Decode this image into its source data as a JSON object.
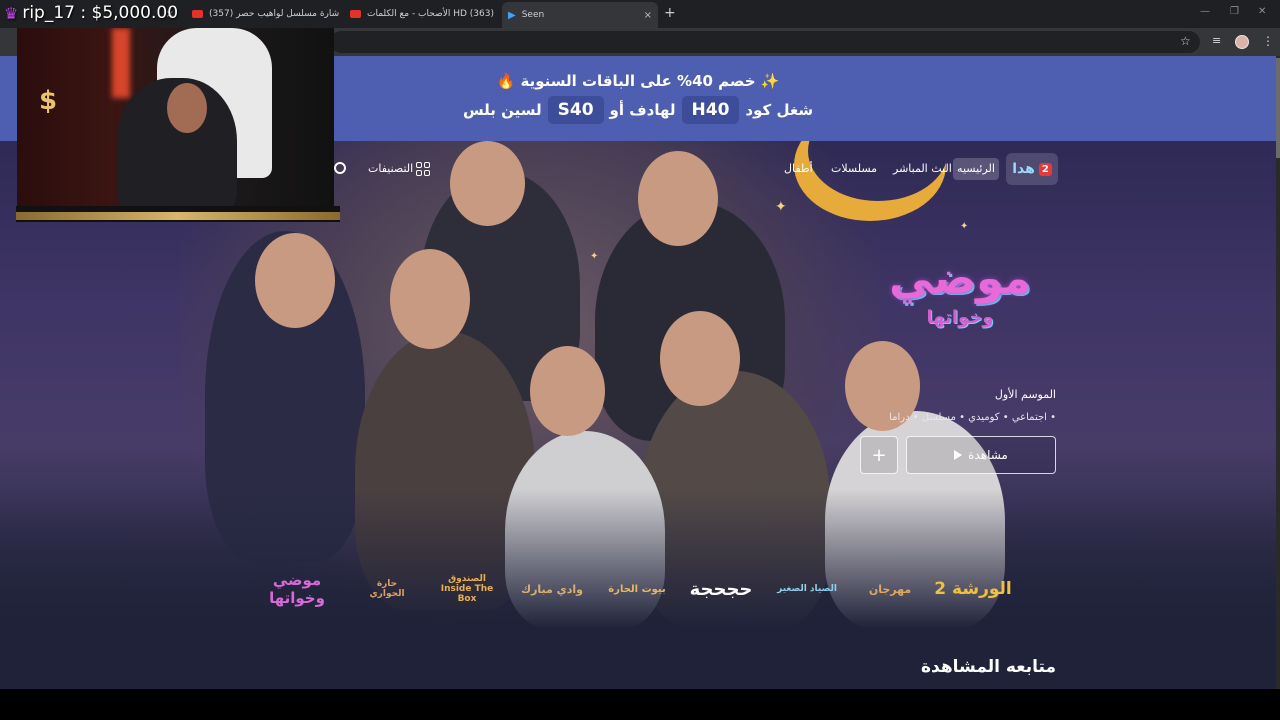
{
  "browser": {
    "tabs": [
      {
        "title": "(357) شارة مسلسل لواهيب حصر",
        "close": "×"
      },
      {
        "title": "الأصحاب - مع الكلمات HD (363)",
        "close": "×"
      },
      {
        "title": "Seen",
        "close": "×",
        "active": true
      }
    ],
    "prefix_tab_close": "×",
    "newtab": "+",
    "window_controls": [
      "—",
      "❐",
      "✕"
    ],
    "star_icon": "☆",
    "menu_icon": "⋮"
  },
  "overlay": {
    "donation_label": "rip_17 : $5,000.00",
    "crown_icon": "♛",
    "cam_dollar": "$"
  },
  "promo": {
    "line1": "خصم 40% على الباقات السنوية",
    "line1_prefix_icon": "✨",
    "line1_suffix_icon": "🔥",
    "line2_start": "شغل كود",
    "code1": "H40",
    "line2_mid": "لهادف أو",
    "code2": "S40",
    "line2_end": "لسين بلس"
  },
  "nav": {
    "logo_num": "2",
    "logo_txt": "ﻫﺪﺍ",
    "home": "الرئيسيه",
    "live": "البث المباشر",
    "series": "مسلسلات",
    "kids": "أطفال",
    "categories": "التصنيفات"
  },
  "show": {
    "logo_big": "موضي",
    "logo_small": "وخواتها",
    "season": "الموسم الأول",
    "genres": "• اجتماعي  • كوميدي  • مسلسل  • دراما",
    "watch_label": "مشاهدة",
    "add_label": "+"
  },
  "rail": [
    {
      "label": "الورشة 2",
      "color": "#f0c040"
    },
    {
      "label": "مهرجان",
      "color": "#e0a860"
    },
    {
      "label": "الصياد الصغير",
      "color": "#8ed0e8"
    },
    {
      "label": "حجحجة",
      "color": "#ffffff"
    },
    {
      "label": "بيوت الحارة",
      "color": "#e8b860"
    },
    {
      "label": "وادي مبارك",
      "color": "#d8b070"
    },
    {
      "label": "الصندوق Inside The Box",
      "color": "#e8b050"
    },
    {
      "label": "حارة الحواري",
      "color": "#e0a060"
    },
    {
      "label": "موضي وخواتها",
      "color": "#d86ad8"
    }
  ],
  "continue_watching": "متابعه المشاهدة"
}
